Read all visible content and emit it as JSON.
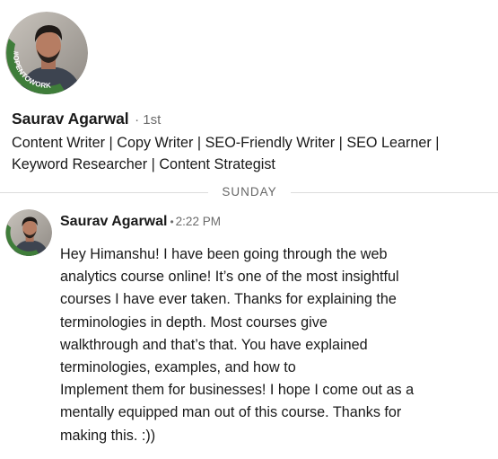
{
  "profile": {
    "name": "Saurav Agarwal",
    "degree": "· 1st",
    "headline": "Content Writer | Copy Writer | SEO-Friendly Writer | SEO Learner | Keyword Researcher | Content Strategist",
    "badge_text": "#OPENTOWORK",
    "avatar_icon": "profile-photo-icon"
  },
  "divider": {
    "label": "SUNDAY"
  },
  "message": {
    "sender": "Saurav Agarwal",
    "separator": "•",
    "time": "2:22 PM",
    "lines": [
      "Hey Himanshu! I have been going through the web",
      "analytics course online! It’s one of the most insightful",
      "courses I have ever taken. Thanks for explaining the",
      "terminologies in depth. Most courses give",
      "walkthrough and that’s that. You have explained",
      "terminologies, examples, and how to",
      "Implement them for businesses! I hope I come out as a",
      "mentally equipped man out of this course. Thanks for",
      "making this. :))"
    ]
  },
  "colors": {
    "badge_green": "#3f7d3a",
    "text": "#191919",
    "muted": "#6b6b6b",
    "divider": "#dcdcdc"
  }
}
